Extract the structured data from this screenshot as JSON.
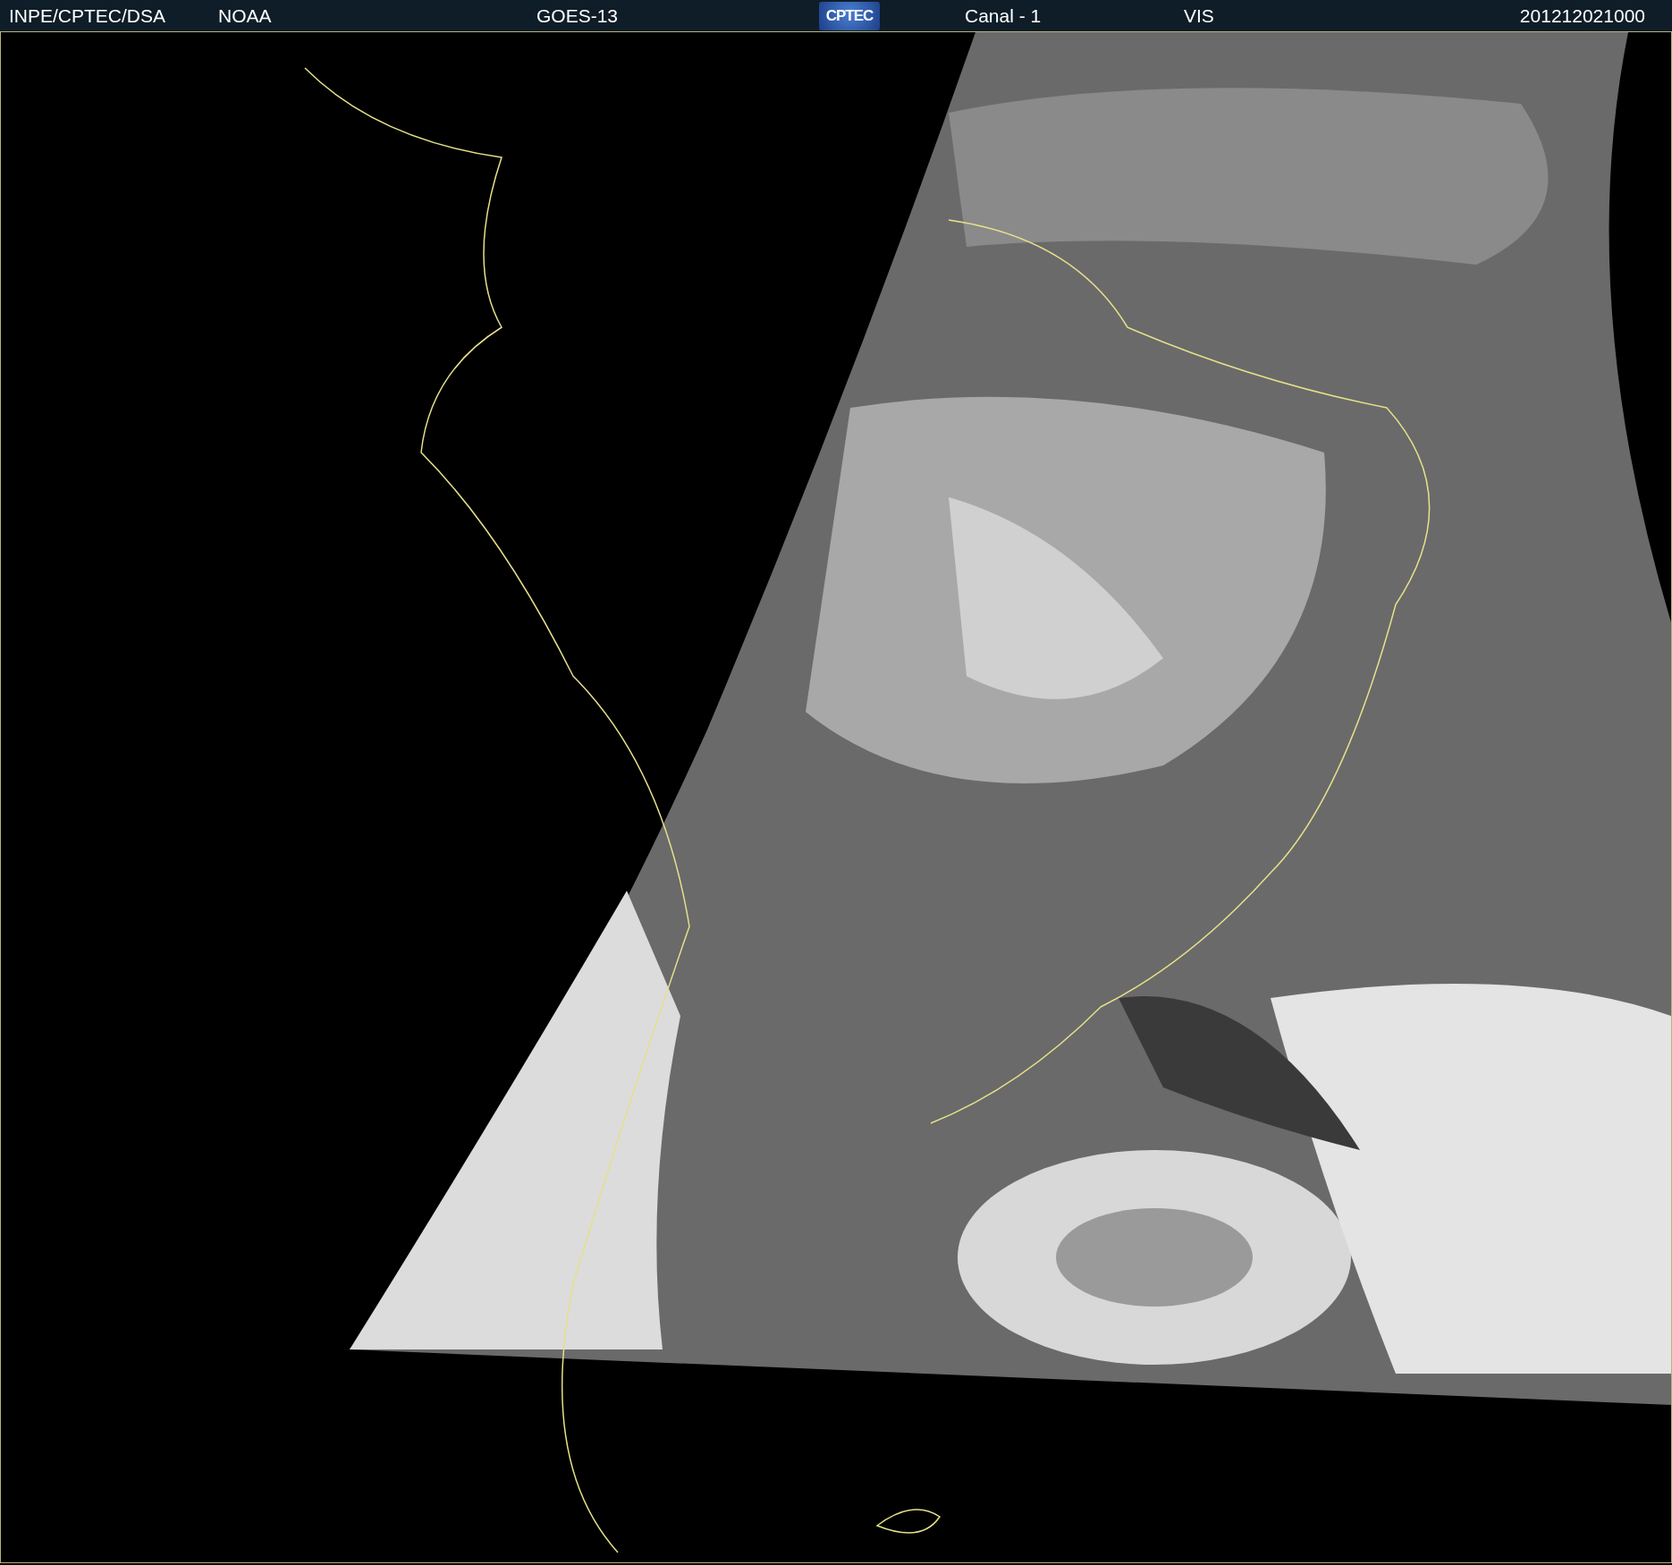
{
  "header": {
    "items": [
      {
        "kind": "text",
        "label": "INPE/CPTEC/DSA"
      },
      {
        "kind": "text",
        "label": "NOAA"
      },
      {
        "kind": "text",
        "label": "GOES-13"
      },
      {
        "kind": "logo",
        "label": "CPTEC"
      },
      {
        "kind": "text",
        "label": "Canal - 1"
      },
      {
        "kind": "text",
        "label": "VIS"
      },
      {
        "kind": "text",
        "label": "201212021000"
      }
    ]
  }
}
